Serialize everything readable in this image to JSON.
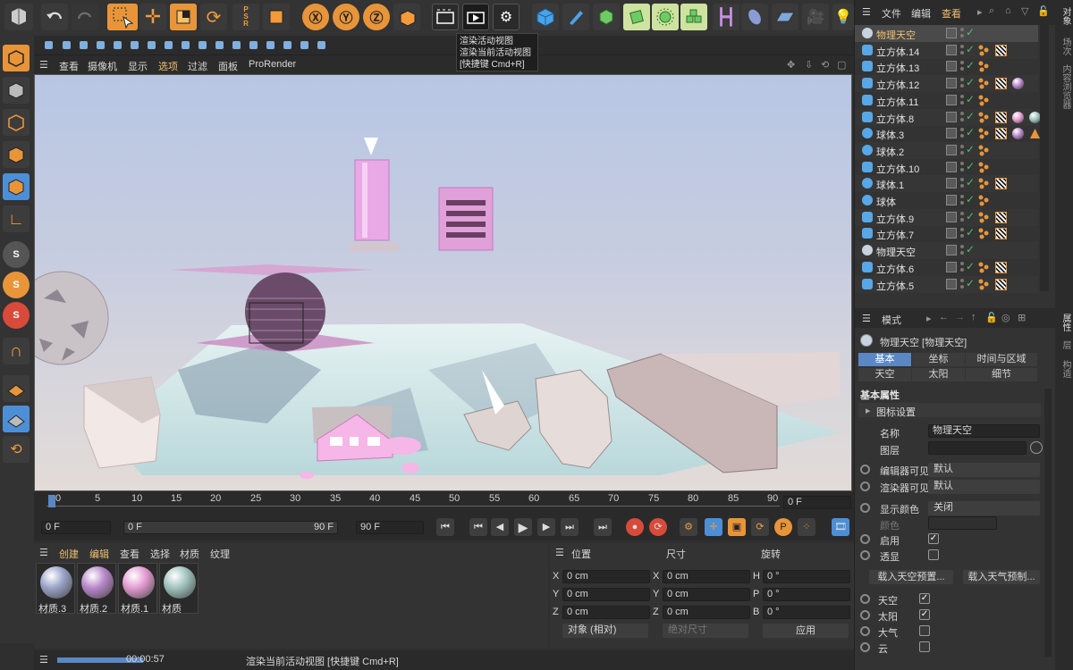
{
  "tooltip": {
    "line1": "渲染活动视图",
    "line2": "渲染当前活动视图",
    "line3": "[快捷键 Cmd+R]"
  },
  "viewport_menu": [
    "查看",
    "摄像机",
    "显示",
    "选项",
    "过滤",
    "面板",
    "ProRender"
  ],
  "objects_panel": {
    "menu": [
      "文件",
      "编辑",
      "查看"
    ],
    "side_tabs": [
      "对象",
      "场次",
      "内容浏览器"
    ],
    "rows": [
      {
        "name": "物理天空",
        "icon": "sky-icon",
        "selected": true,
        "tags": []
      },
      {
        "name": "立方体.14",
        "icon": "cube-icon",
        "tags": [
          "dots",
          "checker"
        ]
      },
      {
        "name": "立方体.13",
        "icon": "cube-icon",
        "tags": [
          "dots"
        ]
      },
      {
        "name": "立方体.12",
        "icon": "cube-icon",
        "tags": [
          "dots",
          "checker",
          "sphere-purple"
        ]
      },
      {
        "name": "立方体.11",
        "icon": "cube-icon",
        "tags": [
          "dots"
        ]
      },
      {
        "name": "立方体.8",
        "icon": "cube-icon",
        "tags": [
          "dots",
          "checker",
          "sphere-pink",
          "sphere-teal"
        ]
      },
      {
        "name": "球体.3",
        "icon": "sphere-icon",
        "tags": [
          "dots",
          "checker",
          "sphere-purple",
          "triangle"
        ]
      },
      {
        "name": "球体.2",
        "icon": "sphere-icon",
        "tags": [
          "dots"
        ]
      },
      {
        "name": "立方体.10",
        "icon": "cube-icon",
        "tags": [
          "dots"
        ]
      },
      {
        "name": "球体.1",
        "icon": "sphere-icon",
        "tags": [
          "dots",
          "checker"
        ]
      },
      {
        "name": "球体",
        "icon": "sphere-icon",
        "tags": [
          "dots"
        ]
      },
      {
        "name": "立方体.9",
        "icon": "cube-icon",
        "tags": [
          "dots",
          "checker"
        ]
      },
      {
        "name": "立方体.7",
        "icon": "cube-icon",
        "tags": [
          "dots",
          "checker"
        ]
      },
      {
        "name": "物理天空",
        "icon": "sky-icon",
        "tags": []
      },
      {
        "name": "立方体.6",
        "icon": "cube-icon",
        "tags": [
          "dots",
          "checker"
        ]
      },
      {
        "name": "立方体.5",
        "icon": "cube-icon",
        "tags": [
          "dots",
          "checker"
        ]
      }
    ]
  },
  "attributes": {
    "mode": "模式",
    "side_tabs": [
      "属性",
      "层",
      "构造"
    ],
    "object_title": "物理天空 [物理天空]",
    "tabs_row1": [
      "基本",
      "坐标",
      "时间与区域"
    ],
    "tabs_row2": [
      "天空",
      "太阳",
      "细节"
    ],
    "section": "基本属性",
    "icon_settings": "图标设置",
    "name_label": "名称",
    "name_value": "物理天空",
    "layer_label": "图层",
    "editor_visible_label": "编辑器可见",
    "editor_visible_value": "默认",
    "render_visible_label": "渲染器可见",
    "render_visible_value": "默认",
    "display_color_label": "显示颜色",
    "display_color_value": "关闭",
    "color_label": "颜色",
    "enabled_label": "启用",
    "transparency_label": "透显",
    "load_sky_preset": "载入天空预置...",
    "load_atmo_preset": "载入天气预制...",
    "sky_label": "天空",
    "sun_label": "太阳",
    "atmosphere_label": "大气",
    "cloud_label": "云"
  },
  "timeline": {
    "ticks": [
      "0",
      "5",
      "10",
      "15",
      "20",
      "25",
      "30",
      "35",
      "40",
      "45",
      "50",
      "55",
      "60",
      "65",
      "70",
      "75",
      "80",
      "85",
      "90"
    ],
    "current_frame": "0 F",
    "start": "0 F",
    "range_start": "0 F",
    "range_end": "90 F",
    "end": "90 F"
  },
  "materials": {
    "menu": [
      "创建",
      "编辑",
      "查看",
      "选择",
      "材质",
      "纹理"
    ],
    "items": [
      {
        "name": "材质.3",
        "color": "#9aa3c8"
      },
      {
        "name": "材质.2",
        "color": "#b787c9"
      },
      {
        "name": "材质.1",
        "color": "#e49bd1"
      },
      {
        "name": "材质",
        "color": "#9fc2bd"
      }
    ]
  },
  "coords": {
    "headers": [
      "位置",
      "尺寸",
      "旋转"
    ],
    "rows": [
      {
        "axis": "X",
        "pos": "0 cm",
        "size_axis": "X",
        "size": "0 cm",
        "rot_axis": "H",
        "rot": "0 °"
      },
      {
        "axis": "Y",
        "pos": "0 cm",
        "size_axis": "Y",
        "size": "0 cm",
        "rot_axis": "P",
        "rot": "0 °"
      },
      {
        "axis": "Z",
        "pos": "0 cm",
        "size_axis": "Z",
        "size": "0 cm",
        "rot_axis": "B",
        "rot": "0 °"
      }
    ],
    "mode": "对象 (相对)",
    "size_mode": "绝对尺寸",
    "apply": "应用"
  },
  "status": {
    "time": "00:00:57",
    "message": "渲染当前活动视图 [快捷键 Cmd+R]",
    "progress": 1.0
  },
  "colors": {
    "accent": "#e8953a",
    "blue": "#4d8fd6",
    "select": "#5b87c4"
  }
}
